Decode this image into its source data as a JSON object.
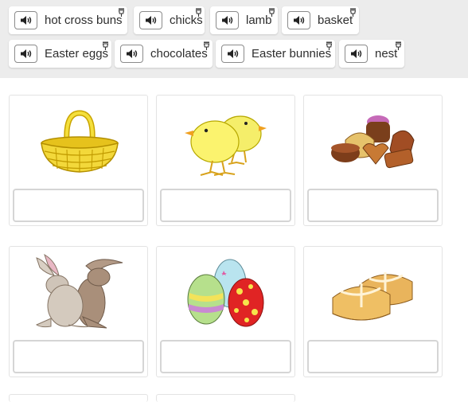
{
  "word_bank": {
    "words": [
      {
        "label": "hot cross buns"
      },
      {
        "label": "chicks"
      },
      {
        "label": "lamb"
      },
      {
        "label": "basket"
      },
      {
        "label": "Easter eggs"
      },
      {
        "label": "chocolates"
      },
      {
        "label": "Easter bunnies"
      },
      {
        "label": "nest"
      }
    ],
    "speaker_icon": "speaker-icon",
    "hint_icon": "hint-icon"
  },
  "cards": [
    {
      "image": "basket",
      "answer": ""
    },
    {
      "image": "chicks",
      "answer": ""
    },
    {
      "image": "chocolates",
      "answer": ""
    },
    {
      "image": "bunnies",
      "answer": ""
    },
    {
      "image": "easter-eggs",
      "answer": ""
    },
    {
      "image": "hot-cross-buns",
      "answer": ""
    }
  ],
  "colors": {
    "bank_background": "#ececec",
    "chip_background": "#ffffff",
    "slot_border": "#d5d5d5",
    "card_border": "#e3e3e3"
  }
}
